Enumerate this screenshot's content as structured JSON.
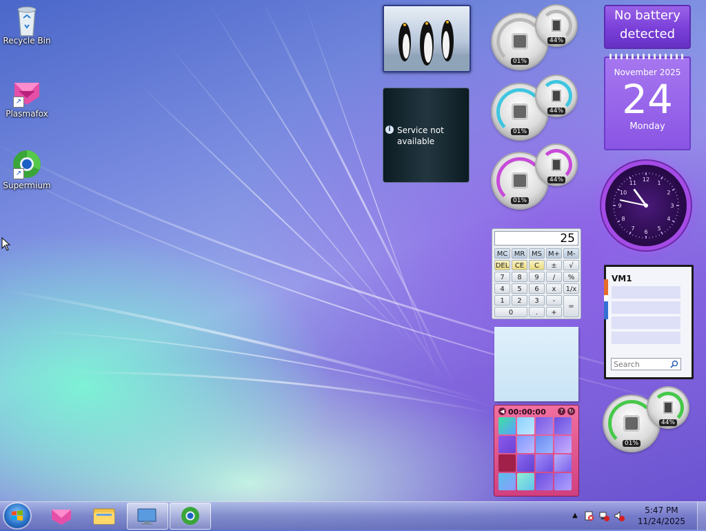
{
  "desktop": {
    "icons": [
      {
        "label": "Recycle Bin",
        "icon": "recycle-bin-icon"
      },
      {
        "label": "Plasmafox",
        "icon": "plasmafox-icon"
      },
      {
        "label": "Supermium",
        "icon": "supermium-icon"
      }
    ]
  },
  "gadgets": {
    "weather": {
      "message_line1": "Service not",
      "message_line2": "available"
    },
    "meters": [
      {
        "cpu": "01%",
        "ram": "44%",
        "accent": "#c0c0c0"
      },
      {
        "cpu": "01%",
        "ram": "44%",
        "accent": "#3ec6e0"
      },
      {
        "cpu": "01%",
        "ram": "44%",
        "accent": "#c64bd8"
      },
      {
        "cpu": "01%",
        "ram": "44%",
        "accent": "#46c84a"
      }
    ],
    "battery": {
      "line1": "No battery",
      "line2": "detected"
    },
    "calendar": {
      "month_year": "November 2025",
      "day": "24",
      "weekday": "Monday"
    },
    "clock": {
      "hours": 10,
      "minutes": 47,
      "numerals": [
        "12",
        "1",
        "2",
        "3",
        "4",
        "5",
        "6",
        "7",
        "8",
        "9",
        "10",
        "11"
      ]
    },
    "calculator": {
      "display": "25",
      "buttons": [
        [
          "MC",
          "MR",
          "MS",
          "M+",
          "M-"
        ],
        [
          "DEL",
          "CE",
          "C",
          "±",
          "√"
        ],
        [
          "7",
          "8",
          "9",
          "/",
          "%"
        ],
        [
          "4",
          "5",
          "6",
          "x",
          "1/x"
        ],
        [
          "1",
          "2",
          "3",
          "-",
          "="
        ],
        [
          "0",
          ".",
          "+"
        ]
      ]
    },
    "feed": {
      "title": "VM1",
      "search_placeholder": "Search"
    },
    "puzzle": {
      "timer": "00:00:00"
    }
  },
  "taskbar": {
    "clock_time": "5:47 PM",
    "clock_date": "11/24/2025"
  }
}
